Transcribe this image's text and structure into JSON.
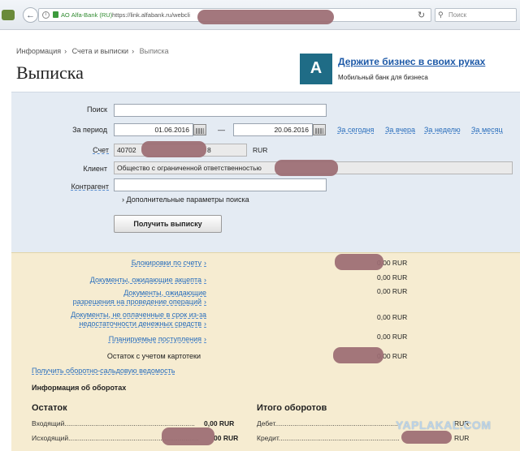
{
  "browser": {
    "site_label": "АО Alfa-Bank (RU)",
    "url": "https://link.alfabank.ru/webcli",
    "search_placeholder": "Поиск"
  },
  "breadcrumb": [
    "Информация",
    "Счета и выписки",
    "Выписка"
  ],
  "page_title": "Выписка",
  "promo": {
    "title": "Держите бизнес в своих руках",
    "subtitle": "Мобильный банк для бизнеса",
    "logo": "А"
  },
  "form": {
    "search_label": "Поиск",
    "search_value": "",
    "period_label": "За период",
    "date_from": "01.06.2016",
    "date_to": "20.06.2016",
    "dash": "—",
    "quick": [
      "За сегодня",
      "За вчера",
      "За неделю",
      "За месяц"
    ],
    "account_label": "Счет",
    "account_prefix": "40702",
    "account_suffix": "8",
    "currency": "RUR",
    "client_label": "Клиент",
    "client_value": "Общество с ограниченной ответственностью",
    "contractor_label": "Контрагент",
    "more_params": "Дополнительные параметры поиска",
    "submit": "Получить выписку"
  },
  "summary": {
    "rows": [
      {
        "label": "Блокировки по счету",
        "value": "0,00 RUR",
        "link": true
      },
      {
        "label": "Документы, ожидающие акцепта",
        "value": "0,00 RUR",
        "link": true
      },
      {
        "label": "Документы, ожидающие\nразрешения на проведение операций",
        "value": "0,00 RUR",
        "link": true
      },
      {
        "label": "Документы, не оплаченные в срок из-за\nнедостаточности денежных средств",
        "value": "0,00 RUR",
        "link": true
      },
      {
        "label": "Планируемые поступления",
        "value": "0,00 RUR",
        "link": true
      },
      {
        "label": "Остаток с учетом картотеки",
        "value": "0,00 RUR",
        "link": false
      }
    ],
    "osv_link": "Получить оборотно-сальдовую ведомость",
    "turnover_title": "Информация об оборотах",
    "balance_title": "Остаток",
    "incoming_label": "Входящий",
    "incoming_value": "0,00 RUR",
    "outgoing_label": "Исходящий",
    "outgoing_value": "00 RUR",
    "totals_title": "Итого оборотов",
    "debit_label": "Дебет",
    "debit_value": "RUR",
    "credit_label": "Кредит",
    "credit_value": "RUR"
  },
  "watermark": "YAPLAKAL.COM"
}
